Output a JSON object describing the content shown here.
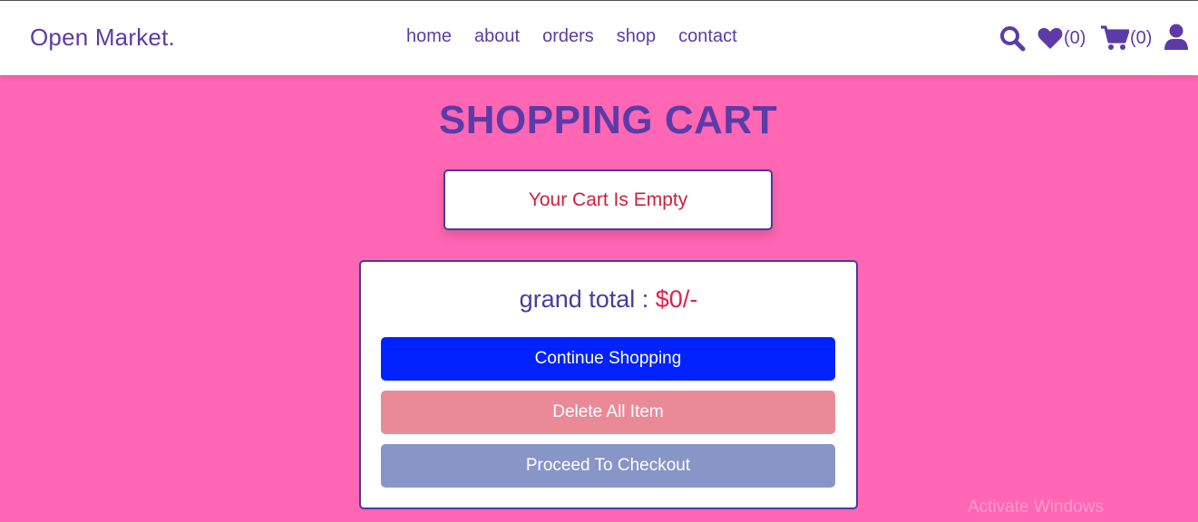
{
  "header": {
    "logo": "Open Market.",
    "nav": [
      {
        "label": "home"
      },
      {
        "label": "about"
      },
      {
        "label": "orders"
      },
      {
        "label": "shop"
      },
      {
        "label": "contact"
      }
    ],
    "icons": {
      "search": "search-icon",
      "wishlist": "heart-icon",
      "wishlist_count": "(0)",
      "cart": "cart-icon",
      "cart_count": "(0)",
      "user": "user-icon"
    }
  },
  "main": {
    "title": "SHOPPING CART",
    "empty_message": "Your Cart Is Empty",
    "grand_total_label": "grand total : ",
    "grand_total_value": "$0/-",
    "buttons": {
      "continue": "Continue Shopping",
      "delete_all": "Delete All Item",
      "checkout": "Proceed To Checkout"
    }
  },
  "system": {
    "watermark": "Activate Windows"
  },
  "colors": {
    "page_background": "#ff66b3",
    "brand": "#5b3ba8",
    "accent_red": "#d0203a",
    "continue_button": "#0022ff",
    "delete_button": "#ea8a99",
    "checkout_button": "#8795c7"
  }
}
